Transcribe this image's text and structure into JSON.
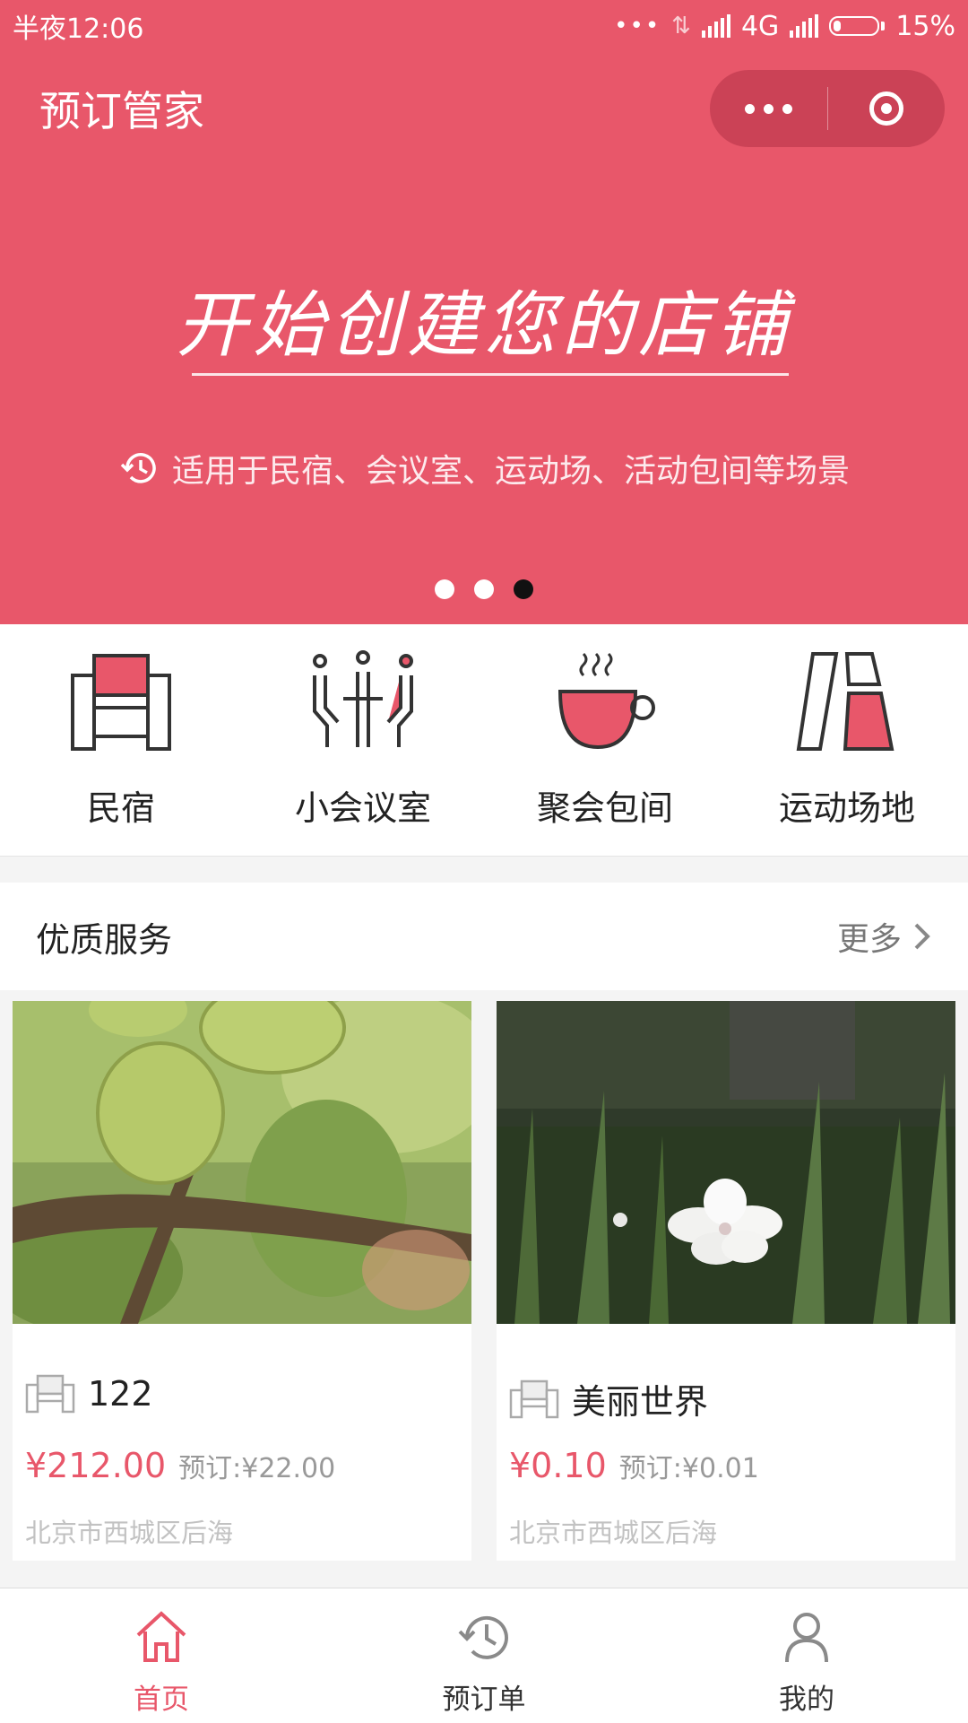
{
  "status_bar": {
    "time": "半夜12:06",
    "network": "4G",
    "battery": "15%"
  },
  "header": {
    "title": "预订管家"
  },
  "banner": {
    "headline": "开始创建您的店铺",
    "subtitle": "适用于民宿、会议室、运动场、活动包间等场景",
    "page_count": 3,
    "active_page": 3
  },
  "categories": [
    {
      "label": "民宿",
      "icon": "sofa-icon"
    },
    {
      "label": "小会议室",
      "icon": "meeting-icon"
    },
    {
      "label": "聚会包间",
      "icon": "coffee-cup-icon"
    },
    {
      "label": "运动场地",
      "icon": "sports-field-icon"
    }
  ],
  "section": {
    "title": "优质服务",
    "more": "更多"
  },
  "listings": [
    {
      "name": "122",
      "price": "¥212.00",
      "deposit": "预订:¥22.00",
      "address": "北京市西城区后海"
    },
    {
      "name": "美丽世界",
      "price": "¥0.10",
      "deposit": "预订:¥0.01",
      "address": "北京市西城区后海"
    }
  ],
  "tabs": [
    {
      "label": "首页",
      "icon": "home-icon",
      "active": true
    },
    {
      "label": "预订单",
      "icon": "history-icon",
      "active": false
    },
    {
      "label": "我的",
      "icon": "user-icon",
      "active": false
    }
  ],
  "colors": {
    "brand": "#e8576a"
  }
}
